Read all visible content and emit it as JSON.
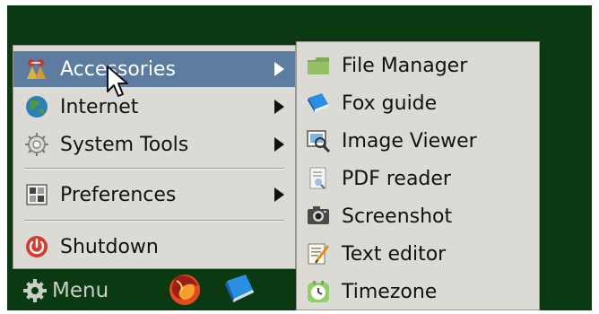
{
  "taskbar": {
    "menu_label": "Menu",
    "icons": [
      "gear-icon",
      "firefox-icon",
      "fox-guide-icon"
    ]
  },
  "main_menu": {
    "items": [
      {
        "label": "Accessories",
        "icon": "accessories-icon",
        "submenu": true,
        "active": true
      },
      {
        "label": "Internet",
        "icon": "globe-icon",
        "submenu": true
      },
      {
        "label": "System Tools",
        "icon": "gear-icon",
        "submenu": true
      },
      {
        "label": "Preferences",
        "icon": "preferences-icon",
        "submenu": true
      },
      {
        "label": "Shutdown",
        "icon": "power-icon",
        "submenu": false
      }
    ]
  },
  "submenu": {
    "title": "Accessories",
    "items": [
      {
        "label": "File Manager",
        "icon": "folder-icon"
      },
      {
        "label": "Fox guide",
        "icon": "book-icon"
      },
      {
        "label": "Image Viewer",
        "icon": "image-viewer-icon"
      },
      {
        "label": "PDF reader",
        "icon": "pdf-reader-icon"
      },
      {
        "label": "Screenshot",
        "icon": "camera-icon"
      },
      {
        "label": "Text editor",
        "icon": "text-editor-icon"
      },
      {
        "label": "Timezone",
        "icon": "clock-icon"
      }
    ]
  },
  "colors": {
    "desktop": "#0b3a12",
    "menu_bg": "#dcdad5",
    "highlight": "#5d7da0",
    "text": "#111111",
    "taskbar_text": "#c8cfc6"
  }
}
